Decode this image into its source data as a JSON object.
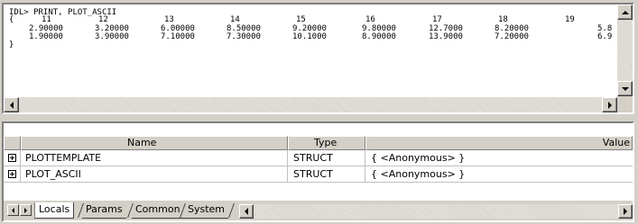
{
  "console": {
    "lines": [
      "IDL> PRINT, PLOT_ASCII",
      "{",
      "}"
    ],
    "row_x": [
      "11",
      "12",
      "13",
      "14",
      "15",
      "16",
      "17",
      "18",
      "19"
    ],
    "row_y1": [
      "2.90000",
      "3.20000",
      "6.00000",
      "8.50000",
      "9.20000",
      "9.80000",
      "12.7000",
      "8.20000",
      "5.8"
    ],
    "row_y2": [
      "1.90000",
      "3.90000",
      "7.10000",
      "7.30000",
      "10.1000",
      "8.90000",
      "13.9000",
      "7.20000",
      "6.9"
    ]
  },
  "variables": {
    "columns": {
      "name": "Name",
      "type": "Type",
      "value": "Value"
    },
    "rows": [
      {
        "name": "PLOTTEMPLATE",
        "type": "STRUCT",
        "value": "{ <Anonymous> }"
      },
      {
        "name": "PLOT_ASCII",
        "type": "STRUCT",
        "value": "{ <Anonymous> }"
      }
    ]
  },
  "tabs": [
    "Locals",
    "Params",
    "Common",
    "System"
  ]
}
